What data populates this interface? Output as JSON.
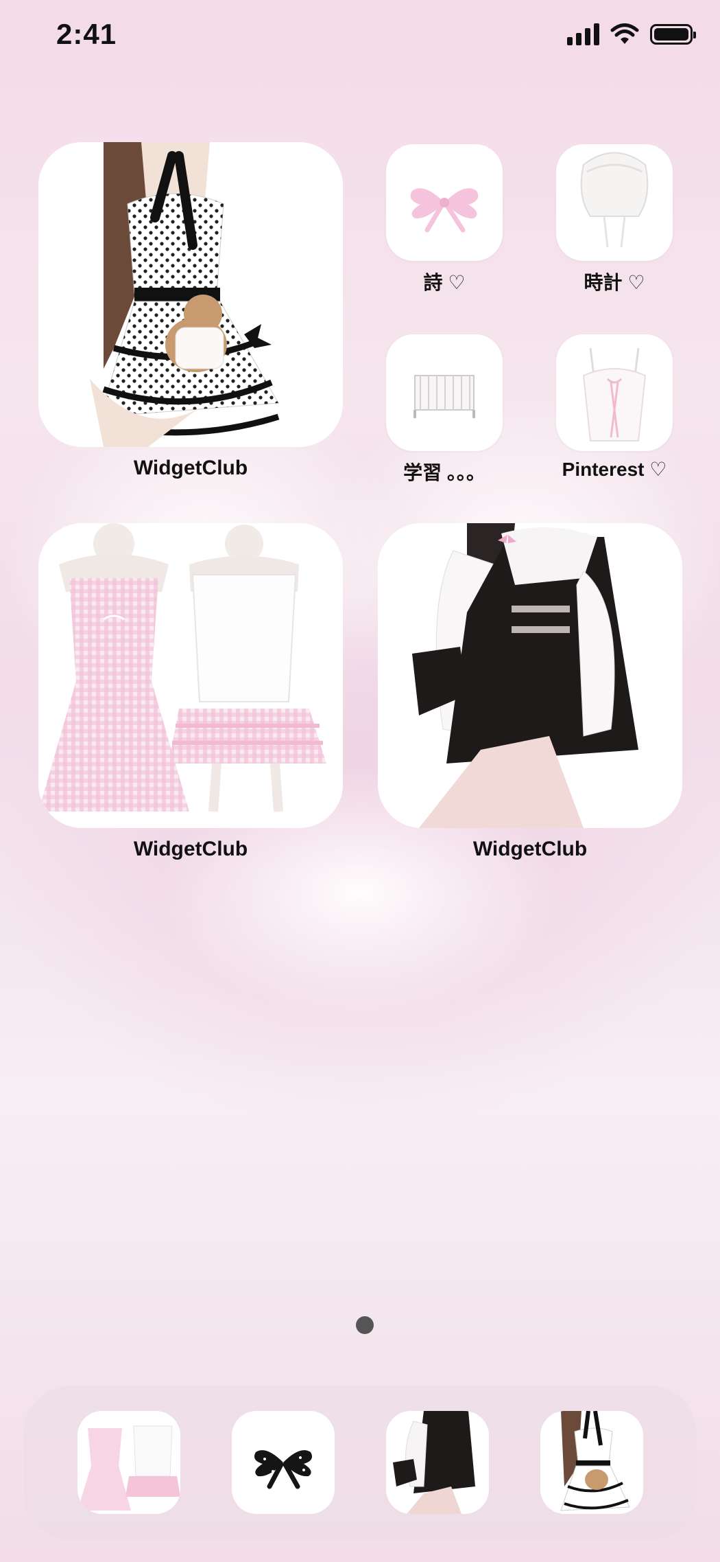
{
  "status_bar": {
    "time": "2:41"
  },
  "widgets": [
    {
      "label": "WidgetClub"
    },
    {
      "label": "WidgetClub"
    },
    {
      "label": "WidgetClub"
    }
  ],
  "apps": [
    {
      "label": "詩 ♡"
    },
    {
      "label": "時計 ♡"
    },
    {
      "label": "学習 。。。"
    },
    {
      "label": "Pinterest ♡"
    }
  ],
  "colors": {
    "accent_pink": "#f3c6dc",
    "dot": "#555555",
    "text": "#111111"
  }
}
